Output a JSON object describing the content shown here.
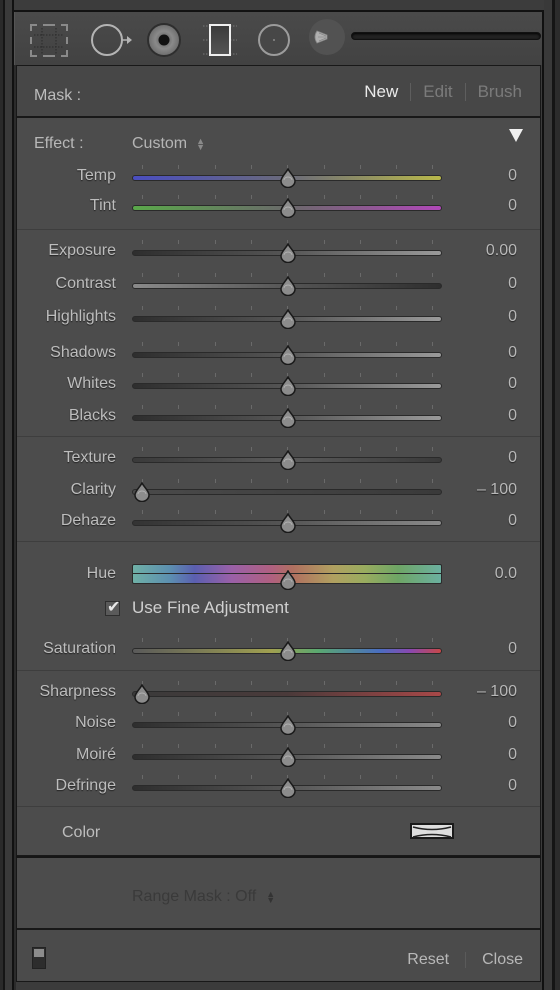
{
  "toolbar": {
    "tools": [
      {
        "name": "crop-overlay",
        "icon": "crop-grid-icon"
      },
      {
        "name": "spot-removal",
        "icon": "spot-removal-icon"
      },
      {
        "name": "red-eye",
        "icon": "red-eye-icon"
      },
      {
        "name": "graduated-filter",
        "icon": "graduated-filter-icon"
      },
      {
        "name": "radial-filter",
        "icon": "radial-filter-icon"
      },
      {
        "name": "adjustment-brush",
        "icon": "adjustment-brush-icon"
      }
    ]
  },
  "mask": {
    "label": "Mask :",
    "modes": [
      "New",
      "Edit",
      "Brush"
    ],
    "active_mode": "New"
  },
  "effect": {
    "label": "Effect :",
    "value": "Custom"
  },
  "sliders": {
    "temp": {
      "label": "Temp",
      "value": "0",
      "position": 0.5
    },
    "tint": {
      "label": "Tint",
      "value": "0",
      "position": 0.5
    },
    "exposure": {
      "label": "Exposure",
      "value": "0.00",
      "position": 0.5
    },
    "contrast": {
      "label": "Contrast",
      "value": "0",
      "position": 0.5
    },
    "highlights": {
      "label": "Highlights",
      "value": "0",
      "position": 0.5
    },
    "shadows": {
      "label": "Shadows",
      "value": "0",
      "position": 0.5
    },
    "whites": {
      "label": "Whites",
      "value": "0",
      "position": 0.5
    },
    "blacks": {
      "label": "Blacks",
      "value": "0",
      "position": 0.5
    },
    "texture": {
      "label": "Texture",
      "value": "0",
      "position": 0.5
    },
    "clarity": {
      "label": "Clarity",
      "value": "– 100",
      "position": 0.0
    },
    "dehaze": {
      "label": "Dehaze",
      "value": "0",
      "position": 0.5
    },
    "hue": {
      "label": "Hue",
      "value": "0.0",
      "position": 0.5
    },
    "saturation": {
      "label": "Saturation",
      "value": "0",
      "position": 0.5
    },
    "sharpness": {
      "label": "Sharpness",
      "value": "– 100",
      "position": 0.0
    },
    "noise": {
      "label": "Noise",
      "value": "0",
      "position": 0.5
    },
    "moire": {
      "label": "Moiré",
      "value": "0",
      "position": 0.5
    },
    "defringe": {
      "label": "Defringe",
      "value": "0",
      "position": 0.5
    }
  },
  "fine_adjustment": {
    "label": "Use Fine Adjustment",
    "checked": true
  },
  "color": {
    "label": "Color",
    "swatch": "none"
  },
  "range_mask": {
    "label": "Range Mask : Off"
  },
  "footer": {
    "reset": "Reset",
    "close": "Close"
  },
  "colors": {
    "panel_bg": "#4c4c4c",
    "active_text": "#eaeaea",
    "inactive_text": "#7b7b7b"
  }
}
